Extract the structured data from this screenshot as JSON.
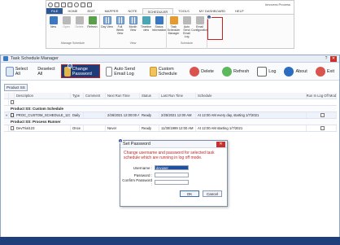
{
  "ribbon": {
    "app_title": "Innovera Process",
    "tabs": [
      "FILE",
      "HOME",
      "EDIT",
      "MAPPER",
      "NOTE",
      "SCHEDULER",
      "TOOLS",
      "MY DASHBOARD",
      "HELP"
    ],
    "active_tab": "SCHEDULER",
    "groups": [
      {
        "label": "Manage Schedule",
        "items": [
          "New",
          "Open",
          "Delete",
          "Refresh"
        ]
      },
      {
        "label": "View",
        "items": [
          "Day View",
          "Full Week View",
          "Month View",
          "Timeline view",
          "Status Information"
        ]
      },
      {
        "label": "Schedule",
        "items": [
          "Task Scheduler Manager",
          "Auto Send Email Log",
          "Email Configuration"
        ]
      }
    ],
    "badge": "1"
  },
  "window": {
    "title": "Task Schedule Manager",
    "controls": {
      "help": "?",
      "close": "✕"
    }
  },
  "toolbar": {
    "select_all": "Select All",
    "deselect_all": "Deselect All",
    "change_password": "Change Password",
    "change_password_badge": "2",
    "auto_send_email_log": "Auto Send Email Log",
    "custom_schedule": "Custom Schedule",
    "delete": "Delete",
    "refresh": "Refresh",
    "log": "Log",
    "about": "About",
    "exit": "Exit"
  },
  "filter": {
    "chip": "Product SS"
  },
  "grid": {
    "headers": [
      "",
      "",
      "Description",
      "Type",
      "Comment",
      "Next Run Time",
      "Status",
      "Last Run Time",
      "Schedule",
      "Run In Log Off Mode"
    ],
    "groups": [
      {
        "label": "Product SS: Custom Schedule",
        "rows": [
          {
            "marker": "»",
            "checked": true,
            "cells": [
              "PROC_CUSTOM_SCHEDULE_123",
              "Daily",
              "",
              "2/26/2021 12:00:00 AM",
              "Ready",
              "2/25/2021 12:00 AM",
              "At 12:00 AM every day, starting 1/7/2021",
              ""
            ]
          }
        ]
      },
      {
        "label": "Product SS: Process Runner",
        "rows": [
          {
            "marker": "",
            "checked": false,
            "cells": [
              "DevTrial123",
              "Once",
              "",
              "Never",
              "Ready",
              "11/30/1999 12:00 AM",
              "At 12:00 AM starting 1/7/2021",
              ""
            ]
          }
        ]
      }
    ]
  },
  "dialog": {
    "title": "Set Password",
    "badge": "3",
    "message": "Change username and password for selected task schedule which are running in log off mode.",
    "username_label": "Username :",
    "username_value": "devuser",
    "password_label": "Password :",
    "confirm_label": "Confirm Password :",
    "ok": "OK",
    "cancel": "Cancel",
    "close": "✕"
  }
}
